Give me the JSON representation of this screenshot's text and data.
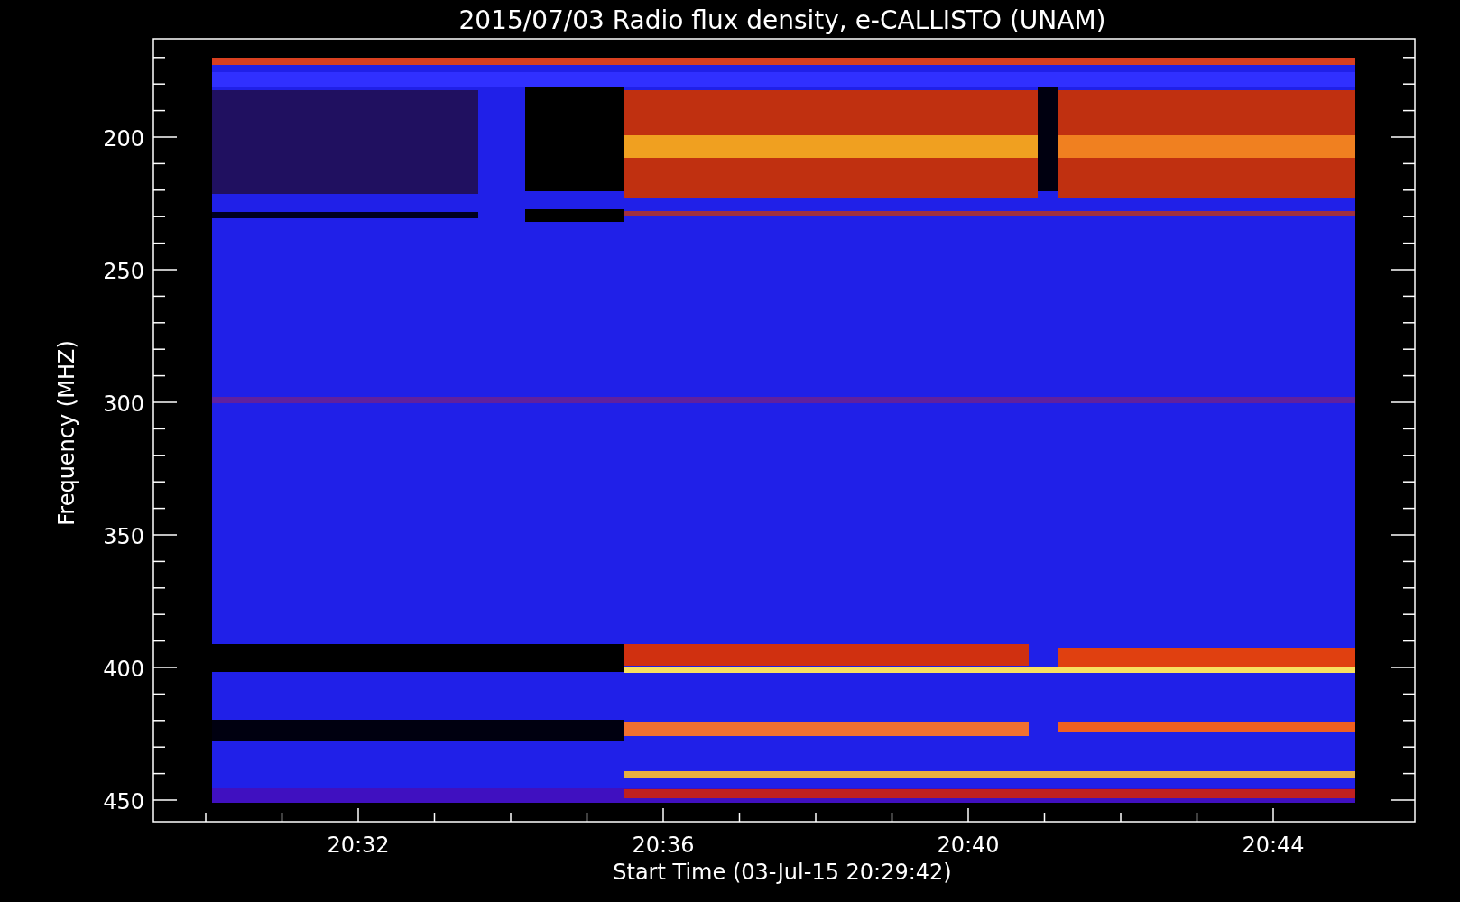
{
  "title": "2015/07/03  Radio flux density, e-CALLISTO (UNAM)",
  "plot": {
    "ylabel": "Frequency (MHZ)",
    "xlabel": "Start Time (03-Jul-15 20:29:42)",
    "yticks": [
      "200",
      "250",
      "300",
      "350",
      "400",
      "450"
    ],
    "xticks": [
      "20:32",
      "20:36",
      "20:40",
      "20:44"
    ]
  }
}
